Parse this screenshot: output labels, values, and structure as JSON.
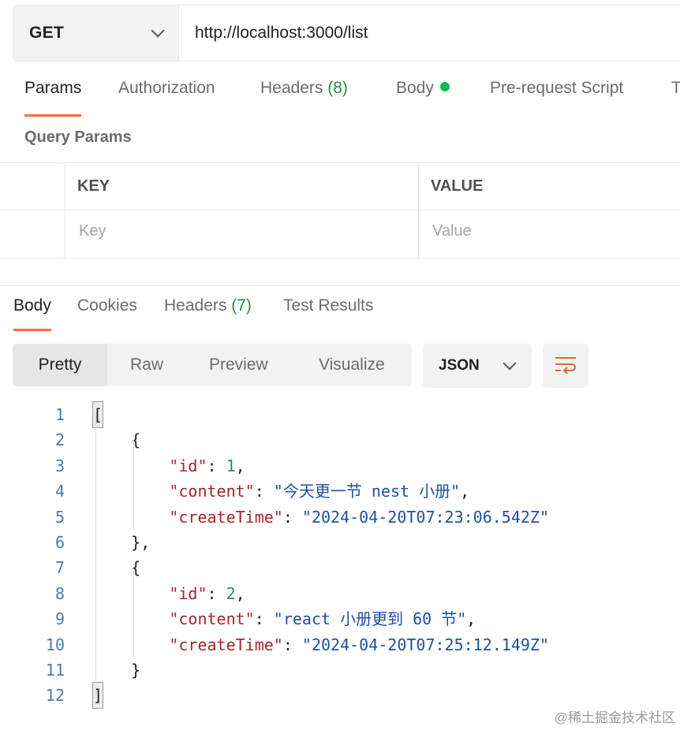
{
  "request": {
    "method": "GET",
    "url": "http://localhost:3000/list"
  },
  "request_tabs": [
    {
      "label": "Params",
      "active": true
    },
    {
      "label": "Authorization"
    },
    {
      "label": "Headers",
      "count": "(8)"
    },
    {
      "label": "Body",
      "indicator": "green-dot"
    },
    {
      "label": "Pre-request Script"
    },
    {
      "label": "T"
    }
  ],
  "query_params": {
    "title": "Query Params",
    "headers": [
      "KEY",
      "VALUE"
    ],
    "placeholders": [
      "Key",
      "Value"
    ]
  },
  "response_tabs": [
    {
      "label": "Body",
      "active": true
    },
    {
      "label": "Cookies"
    },
    {
      "label": "Headers",
      "count": "(7)"
    },
    {
      "label": "Test Results"
    }
  ],
  "view_modes": [
    "Pretty",
    "Raw",
    "Preview",
    "Visualize"
  ],
  "active_view_mode": "Pretty",
  "format": "JSON",
  "wrap_icon": "wrap-lines-icon",
  "accent_color": "#ff6c37",
  "code_lines": [
    {
      "n": "1",
      "parts": [
        [
          "bracket-box",
          "["
        ]
      ]
    },
    {
      "n": "2",
      "parts": [
        [
          "plain",
          "    {"
        ]
      ]
    },
    {
      "n": "3",
      "parts": [
        [
          "plain",
          "        "
        ],
        [
          "key",
          "\"id\""
        ],
        [
          "plain",
          ": "
        ],
        [
          "num",
          "1"
        ],
        [
          "plain",
          ","
        ]
      ]
    },
    {
      "n": "4",
      "parts": [
        [
          "plain",
          "        "
        ],
        [
          "key",
          "\"content\""
        ],
        [
          "plain",
          ": "
        ],
        [
          "str",
          "\"今天更一节 nest 小册\""
        ],
        [
          "plain",
          ","
        ]
      ]
    },
    {
      "n": "5",
      "parts": [
        [
          "plain",
          "        "
        ],
        [
          "key",
          "\"createTime\""
        ],
        [
          "plain",
          ": "
        ],
        [
          "str",
          "\"2024-04-20T07:23:06.542Z\""
        ]
      ]
    },
    {
      "n": "6",
      "parts": [
        [
          "plain",
          "    },"
        ]
      ]
    },
    {
      "n": "7",
      "parts": [
        [
          "plain",
          "    {"
        ]
      ]
    },
    {
      "n": "8",
      "parts": [
        [
          "plain",
          "        "
        ],
        [
          "key",
          "\"id\""
        ],
        [
          "plain",
          ": "
        ],
        [
          "num",
          "2"
        ],
        [
          "plain",
          ","
        ]
      ]
    },
    {
      "n": "9",
      "parts": [
        [
          "plain",
          "        "
        ],
        [
          "key",
          "\"content\""
        ],
        [
          "plain",
          ": "
        ],
        [
          "str",
          "\"react 小册更到 60 节\""
        ],
        [
          "plain",
          ","
        ]
      ]
    },
    {
      "n": "10",
      "parts": [
        [
          "plain",
          "        "
        ],
        [
          "key",
          "\"createTime\""
        ],
        [
          "plain",
          ": "
        ],
        [
          "str",
          "\"2024-04-20T07:25:12.149Z\""
        ]
      ]
    },
    {
      "n": "11",
      "parts": [
        [
          "plain",
          "    }"
        ]
      ]
    },
    {
      "n": "12",
      "parts": [
        [
          "bracket-box",
          "]"
        ]
      ]
    }
  ],
  "watermark": "@稀土掘金技术社区"
}
